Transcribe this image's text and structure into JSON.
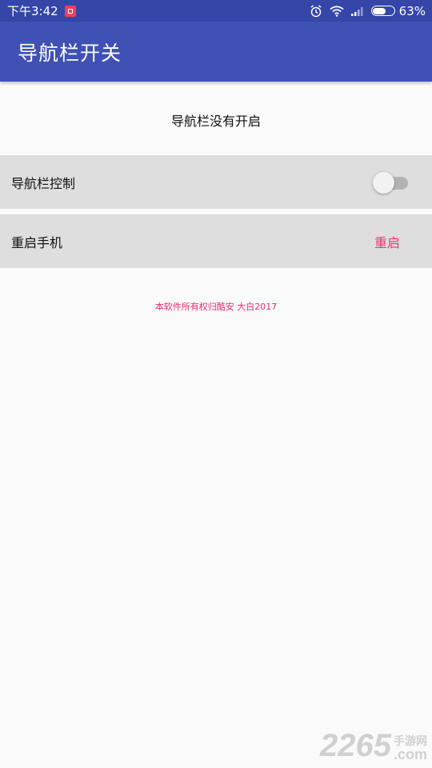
{
  "status_bar": {
    "time": "下午3:42",
    "battery_percent": "63%",
    "battery_level": 0.63,
    "icons": [
      "app-notification-icon",
      "alarm-icon",
      "wifi-icon",
      "signal-icon",
      "battery-icon"
    ]
  },
  "app_bar": {
    "title": "导航栏开关"
  },
  "main": {
    "status_message": "导航栏没有开启",
    "nav_control": {
      "label": "导航栏控制",
      "enabled": false
    },
    "restart": {
      "label": "重启手机",
      "button_label": "重启"
    },
    "copyright": "本软件所有权归酷安 大白2017"
  },
  "watermark": {
    "number": "2265",
    "site_cn": "手游网",
    "site_com": ".com"
  },
  "colors": {
    "status_bar": "#3546a8",
    "app_bar": "#3f51b5",
    "row_bg": "#dedede",
    "accent": "#e63a73"
  }
}
